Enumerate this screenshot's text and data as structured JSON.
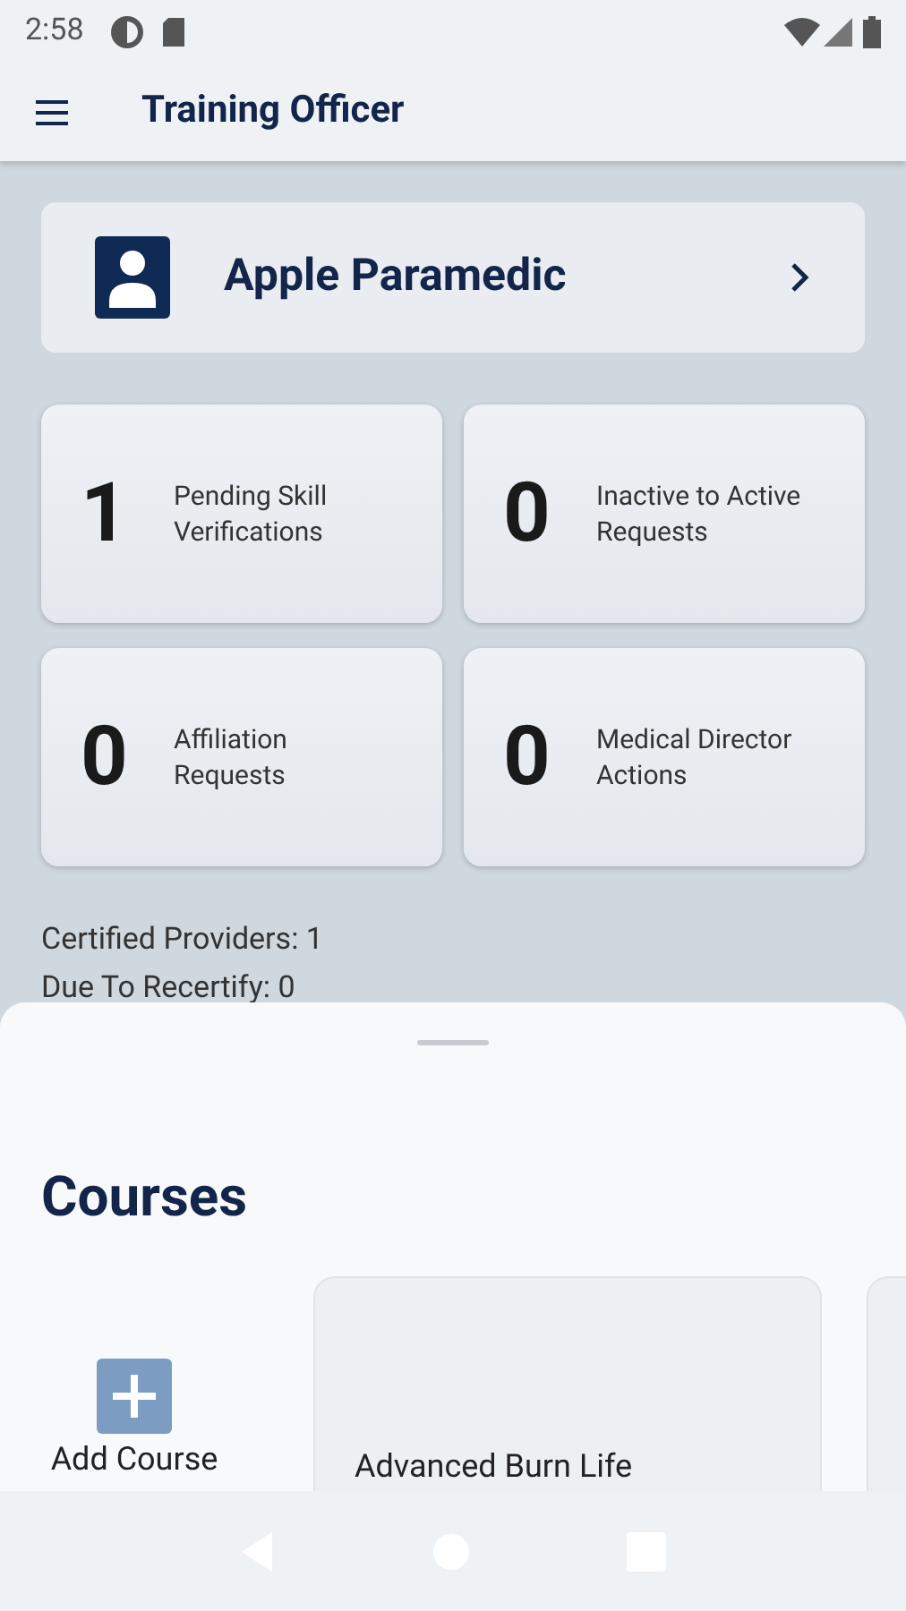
{
  "status_bar": {
    "time": "2:58"
  },
  "app_bar": {
    "title": "Training Officer"
  },
  "profile": {
    "name": "Apple Paramedic"
  },
  "stats": [
    {
      "count": "1",
      "label": "Pending Skill Verifications"
    },
    {
      "count": "0",
      "label": "Inactive to Active Requests"
    },
    {
      "count": "0",
      "label": "Affiliation Requests"
    },
    {
      "count": "0",
      "label": "Medical Director Actions"
    }
  ],
  "summary": [
    "Certified Providers: 1",
    "Due To Recertify: 0"
  ],
  "courses": {
    "title": "Courses",
    "add_label": "Add Course",
    "items": [
      {
        "title": "Advanced Burn Life"
      }
    ]
  }
}
